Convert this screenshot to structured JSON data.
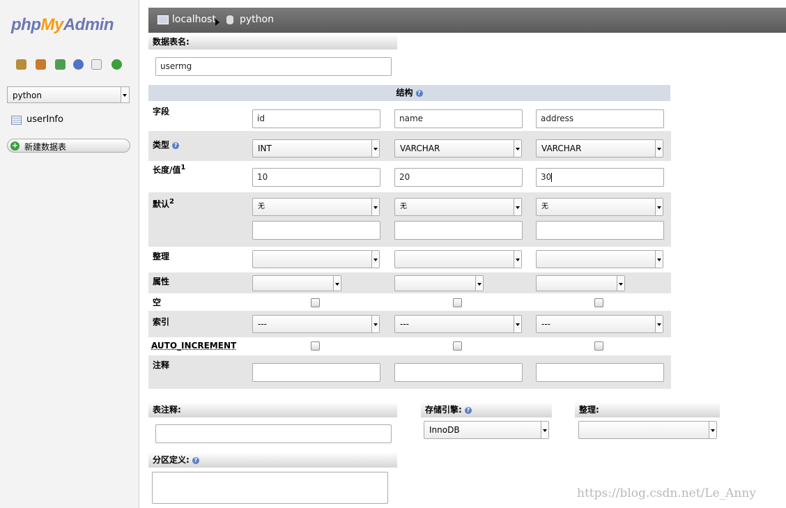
{
  "sidebar": {
    "logo": {
      "php": "php",
      "my": "My",
      "admin": "Admin"
    },
    "db_select": "python",
    "tables": [
      {
        "label": "userInfo"
      }
    ],
    "new_table": "新建数据表"
  },
  "breadcrumb": {
    "server": "localhost",
    "database": "python"
  },
  "table_name": {
    "header": "数据表名:",
    "value": "usermg"
  },
  "structure": {
    "header": "结构",
    "rows": {
      "field": "字段",
      "type": "类型",
      "length": "长度/值",
      "length_sup": "1",
      "default": "默认",
      "default_sup": "2",
      "collation": "整理",
      "attributes": "属性",
      "null": "空",
      "index": "索引",
      "auto_increment": "AUTO_INCREMENT",
      "comment": "注释"
    },
    "columns": [
      {
        "name": "id",
        "type": "INT",
        "length": "10",
        "default": "无",
        "index": "---"
      },
      {
        "name": "name",
        "type": "VARCHAR",
        "length": "20",
        "default": "无",
        "index": "---"
      },
      {
        "name": "address",
        "type": "VARCHAR",
        "length": "30",
        "default": "无",
        "index": "---"
      }
    ]
  },
  "table_comment": {
    "header": "表注释:"
  },
  "storage_engine": {
    "header": "存储引擎:",
    "value": "InnoDB"
  },
  "table_collation": {
    "header": "整理:"
  },
  "partition": {
    "header": "分区定义:"
  },
  "watermark": "https://blog.csdn.net/Le_Anny"
}
